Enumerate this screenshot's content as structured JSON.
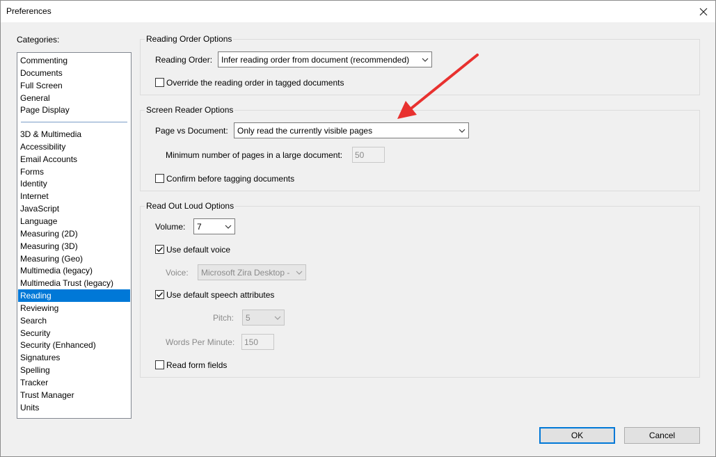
{
  "window": {
    "title": "Preferences",
    "close_icon": "close-icon"
  },
  "categories": {
    "label": "Categories:",
    "group1": [
      "Commenting",
      "Documents",
      "Full Screen",
      "General",
      "Page Display"
    ],
    "group2": [
      "3D & Multimedia",
      "Accessibility",
      "Email Accounts",
      "Forms",
      "Identity",
      "Internet",
      "JavaScript",
      "Language",
      "Measuring (2D)",
      "Measuring (3D)",
      "Measuring (Geo)",
      "Multimedia (legacy)",
      "Multimedia Trust (legacy)",
      "Reading",
      "Reviewing",
      "Search",
      "Security",
      "Security (Enhanced)",
      "Signatures",
      "Spelling",
      "Tracker",
      "Trust Manager",
      "Units"
    ],
    "selected": "Reading"
  },
  "reading_order": {
    "title": "Reading Order Options",
    "order_label": "Reading Order:",
    "order_value": "Infer reading order from document (recommended)",
    "override_label": "Override the reading order in tagged documents",
    "override_checked": false
  },
  "screen_reader": {
    "title": "Screen Reader Options",
    "page_vs_doc_label": "Page vs Document:",
    "page_vs_doc_value": "Only read the currently visible pages",
    "min_pages_label": "Minimum number of pages in a large document:",
    "min_pages_value": "50",
    "confirm_label": "Confirm before tagging documents",
    "confirm_checked": false
  },
  "read_out_loud": {
    "title": "Read Out Loud Options",
    "volume_label": "Volume:",
    "volume_value": "7",
    "default_voice_label": "Use default voice",
    "default_voice_checked": true,
    "voice_label": "Voice:",
    "voice_value": "Microsoft Zira Desktop -",
    "default_speech_label": "Use default speech attributes",
    "default_speech_checked": true,
    "pitch_label": "Pitch:",
    "pitch_value": "5",
    "wpm_label": "Words Per Minute:",
    "wpm_value": "150",
    "form_fields_label": "Read form fields",
    "form_fields_checked": false
  },
  "buttons": {
    "ok": "OK",
    "cancel": "Cancel"
  },
  "annotation": {
    "arrow_color": "#e8312f"
  },
  "colors": {
    "selection": "#0078d7"
  }
}
